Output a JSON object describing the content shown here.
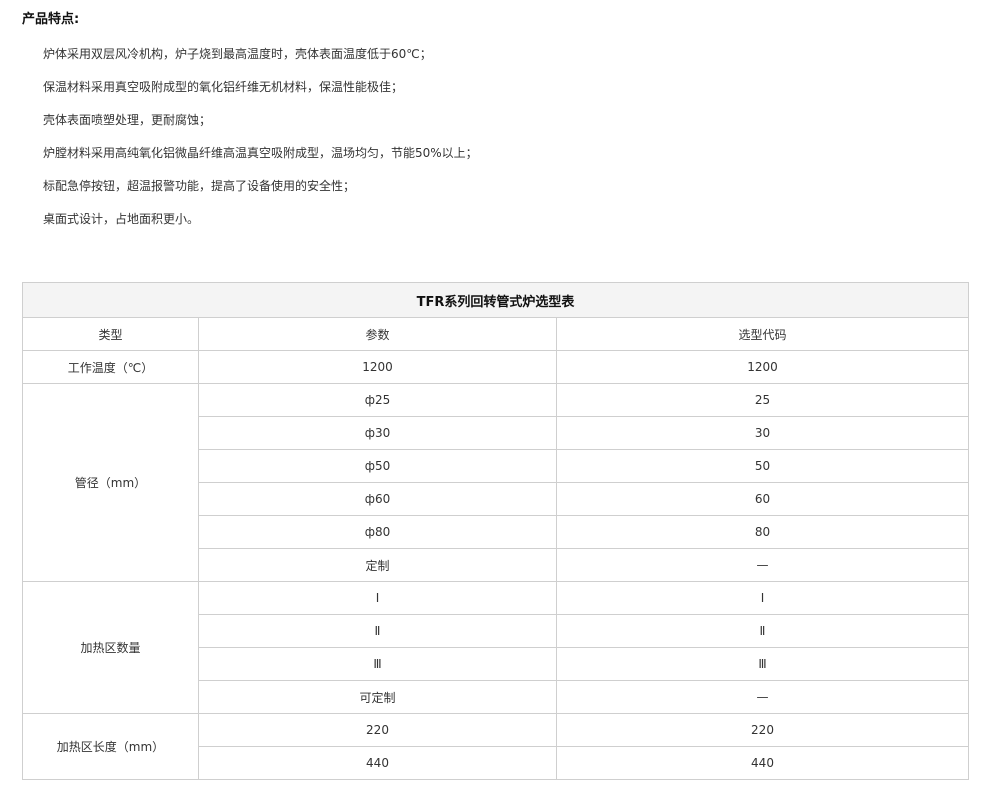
{
  "heading": "产品特点:",
  "features": [
    "炉体采用双层风冷机构，炉子烧到最高温度时，壳体表面温度低于60℃；",
    "保温材料采用真空吸附成型的氧化铝纤维无机材料，保温性能极佳；",
    "壳体表面喷塑处理，更耐腐蚀；",
    "炉膛材料采用高纯氧化铝微晶纤维高温真空吸附成型，温场均匀，节能50%以上；",
    "标配急停按钮，超温报警功能，提高了设备使用的安全性；",
    "桌面式设计，占地面积更小。"
  ],
  "table": {
    "title": "TFR系列回转管式炉选型表",
    "headers": [
      "类型",
      "参数",
      "选型代码"
    ],
    "groups": {
      "temp": {
        "label": "工作温度（℃）",
        "rows": [
          [
            "1200",
            "1200"
          ]
        ]
      },
      "tube": {
        "label": "管径（mm）",
        "rows": [
          [
            "ф25",
            "25"
          ],
          [
            "ф30",
            "30"
          ],
          [
            "ф50",
            "50"
          ],
          [
            "ф60",
            "60"
          ],
          [
            "ф80",
            "80"
          ],
          [
            "定制",
            "—"
          ]
        ]
      },
      "zones": {
        "label": "加热区数量",
        "rows": [
          [
            "Ⅰ",
            "Ⅰ"
          ],
          [
            "Ⅱ",
            "Ⅱ"
          ],
          [
            "Ⅲ",
            "Ⅲ"
          ],
          [
            "可定制",
            "—"
          ]
        ]
      },
      "length": {
        "label": "加热区长度（mm）",
        "rows": [
          [
            "220",
            "220"
          ],
          [
            "440",
            "440"
          ]
        ]
      }
    }
  }
}
